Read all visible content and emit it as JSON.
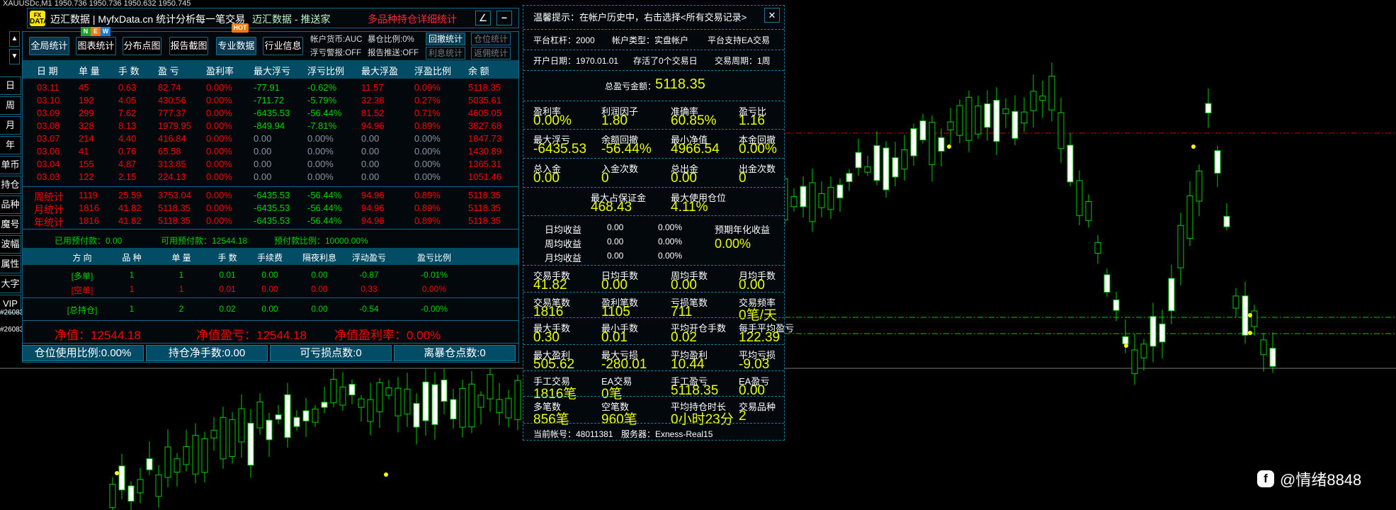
{
  "chart_header": "XAUUSDc,M1  1950.736 1950.736 1950.632 1950.745",
  "title_bar": {
    "logo_top": "FX",
    "logo_bottom": "DATA",
    "brand": "迈汇数据 | MyfxData.cn  统计分析每一笔交易",
    "subtitle": "迈汇数据 - 推送家",
    "panel_title": "多品种持仓详细统计",
    "edit_icon": "∠",
    "minimize_icon": "−"
  },
  "side_nav": {
    "up": "▲",
    "down": "▼",
    "items": [
      "日",
      "周",
      "月",
      "年",
      "单币",
      "持仓",
      "品种",
      "魔号",
      "波幅",
      "属性",
      "大字",
      "VIP"
    ],
    "tags": [
      "#26083",
      "#26083"
    ]
  },
  "toolbar": {
    "buttons": [
      "全局统计",
      "图表统计",
      "分布点图",
      "报告截图",
      "专业数据",
      "行业信息"
    ],
    "badge_new": [
      "N",
      "E",
      "W"
    ],
    "badge_hot": "HOT",
    "info": [
      "帐户货币:AUC",
      "暴仓比例:0%",
      "浮亏警报:OFF",
      "报告推送:OFF"
    ],
    "right_buttons": [
      "回撤统计",
      "仓位统计",
      "利息统计",
      "返佣统计"
    ]
  },
  "daily_table": {
    "headers": [
      "日 期",
      "单 量",
      "手 数",
      "盈 亏",
      "盈利率",
      "最大浮亏",
      "浮亏比例",
      "最大浮盈",
      "浮盈比例",
      "余 额"
    ],
    "rows": [
      [
        "03.11",
        "45",
        "0.63",
        "82.74",
        "0.00%",
        "-77.91",
        "-0.62%",
        "11.57",
        "0.09%",
        "5118.35"
      ],
      [
        "03.10",
        "192",
        "4.05",
        "430.56",
        "0.00%",
        "-711.72",
        "-5.79%",
        "32.38",
        "0.27%",
        "5035.61"
      ],
      [
        "03.09",
        "299",
        "7.62",
        "777.37",
        "0.00%",
        "-6435.53",
        "-56.44%",
        "81.52",
        "0.71%",
        "4605.05"
      ],
      [
        "03.08",
        "328",
        "8.13",
        "1979.95",
        "0.00%",
        "-849.94",
        "-7.81%",
        "94.96",
        "0.89%",
        "3827.68"
      ],
      [
        "03.07",
        "214",
        "4.40",
        "416.84",
        "0.00%",
        "0.00",
        "0.00%",
        "0.00",
        "0.00%",
        "1847.73"
      ],
      [
        "03.06",
        "41",
        "0.76",
        "65.58",
        "0.00%",
        "0.00",
        "0.00%",
        "0.00",
        "0.00%",
        "1430.89"
      ],
      [
        "03.04",
        "155",
        "4.87",
        "313.85",
        "0.00%",
        "0.00",
        "0.00%",
        "0.00",
        "0.00%",
        "1365.31"
      ],
      [
        "03.03",
        "122",
        "2.15",
        "224.13",
        "0.00%",
        "0.00",
        "0.00%",
        "0.00",
        "0.00%",
        "1051.46"
      ]
    ],
    "summary_rows": [
      [
        "周统计",
        "1119",
        "25.59",
        "3753.04",
        "0.00%",
        "-6435.53",
        "-56.44%",
        "94.96",
        "0.89%",
        "5118.35"
      ],
      [
        "月统计",
        "1816",
        "41.82",
        "5118.35",
        "0.00%",
        "-6435.53",
        "-56.44%",
        "94.96",
        "0.89%",
        "5118.35"
      ],
      [
        "年统计",
        "1816",
        "41.82",
        "5118.35",
        "0.00%",
        "-6435.53",
        "-56.44%",
        "94.96",
        "0.89%",
        "5118.35"
      ]
    ]
  },
  "prepay": [
    "已用预付款：0.00",
    "可用预付款：12544.18",
    "预付款比例：10000.00%"
  ],
  "positions": {
    "headers": [
      "方 向",
      "品 种",
      "单 量",
      "手 数",
      "手续费",
      "隔夜利息",
      "浮动盈亏",
      "盈亏比例"
    ],
    "rows": [
      [
        "[多单]",
        "1",
        "1",
        "0.01",
        "0.00",
        "0.00",
        "-0.87",
        "-0.01%"
      ],
      [
        "[空单]",
        "1",
        "1",
        "0.01",
        "0.00",
        "0.00",
        "0.33",
        "0.00%"
      ]
    ],
    "total": [
      "[总持仓]",
      "1",
      "2",
      "0.02",
      "0.00",
      "0.00",
      "-0.54",
      "-0.00%"
    ]
  },
  "equity": [
    "净值：12544.18",
    "净值盈亏：12544.18",
    "净值盈利率：0.00%"
  ],
  "bottom_buttons": [
    "仓位使用比例:0.00%",
    "持仓净手数:0.00",
    "可亏损点数:0",
    "离暴仓点数:0"
  ],
  "stats_panel": {
    "tip": "温馨提示：在帐户历史中，右击选择<所有交易记录>",
    "close_icon": "✕",
    "row_platform": [
      "平台杠杆：2000",
      "帐户类型：实盘帐户",
      "平台支持EA交易"
    ],
    "row_account": [
      "开户日期：1970.01.01",
      "存活了0个交易日",
      "交易周期：1周"
    ],
    "total_label": "总盈亏金额：",
    "total_value": "5118.35",
    "grid_a": [
      [
        [
          "盈利率",
          "0.00%"
        ],
        [
          "利润因子",
          "1.80"
        ],
        [
          "准确率",
          "60.85%"
        ],
        [
          "盈亏比",
          "1.16"
        ]
      ],
      [
        [
          "最大浮亏",
          "-6435.53"
        ],
        [
          "余额回撤",
          "-56.44%"
        ],
        [
          "最小净值",
          "4966.54"
        ],
        [
          "本金回撤",
          "0.00%"
        ]
      ],
      [
        [
          "总入金",
          "0.00"
        ],
        [
          "入金次数",
          "0"
        ],
        [
          "总出金",
          "0.00"
        ],
        [
          "出金次数",
          "0"
        ]
      ]
    ],
    "margin": [
      [
        "最大占保证金",
        "468.43"
      ],
      [
        "最大使用仓位",
        "4.11%"
      ]
    ],
    "income": [
      [
        "日均收益",
        "0.00",
        "0.00%"
      ],
      [
        "周均收益",
        "0.00",
        "0.00%"
      ],
      [
        "月均收益",
        "0.00",
        "0.00%"
      ]
    ],
    "annual_label": "预期年化收益",
    "annual_value": "0.00%",
    "grid_b": [
      [
        [
          "交易手数",
          "41.82"
        ],
        [
          "日均手数",
          "0.00"
        ],
        [
          "周均手数",
          "0.00"
        ],
        [
          "月均手数",
          "0.00"
        ]
      ],
      [
        [
          "交易笔数",
          "1816"
        ],
        [
          "盈利笔数",
          "1105"
        ],
        [
          "亏损笔数",
          "711"
        ],
        [
          "交易频率",
          "0笔/天"
        ]
      ],
      [
        [
          "最大手数",
          "0.30"
        ],
        [
          "最小手数",
          "0.01"
        ],
        [
          "平均开仓手数",
          "0.02"
        ],
        [
          "每手平均盈亏",
          "122.39"
        ]
      ],
      [
        [
          "最大盈利",
          "505.62"
        ],
        [
          "最大亏损",
          "-280.01"
        ],
        [
          "平均盈利",
          "10.44"
        ],
        [
          "平均亏损",
          "-9.03"
        ]
      ],
      [
        [
          "手工交易",
          "1816笔"
        ],
        [
          "EA交易",
          "0笔"
        ],
        [
          "手工盈亏",
          "5118.35"
        ],
        [
          "EA盈亏",
          "0.00"
        ]
      ],
      [
        [
          "多笔数",
          "856笔"
        ],
        [
          "空笔数",
          "960笔"
        ],
        [
          "平均持仓时长",
          "0小时23分"
        ],
        [
          "交易品种",
          "2"
        ]
      ]
    ],
    "footer": [
      "当前帐号：48011381",
      "服务器：Exness-Real15"
    ]
  },
  "watermark": "@情绪8848",
  "colors": {
    "panel_band": "#034c66",
    "border": "#126a8a",
    "profit_red": "#ff0000",
    "loss_green": "#00d400",
    "value_yellow": "#eaff00"
  }
}
